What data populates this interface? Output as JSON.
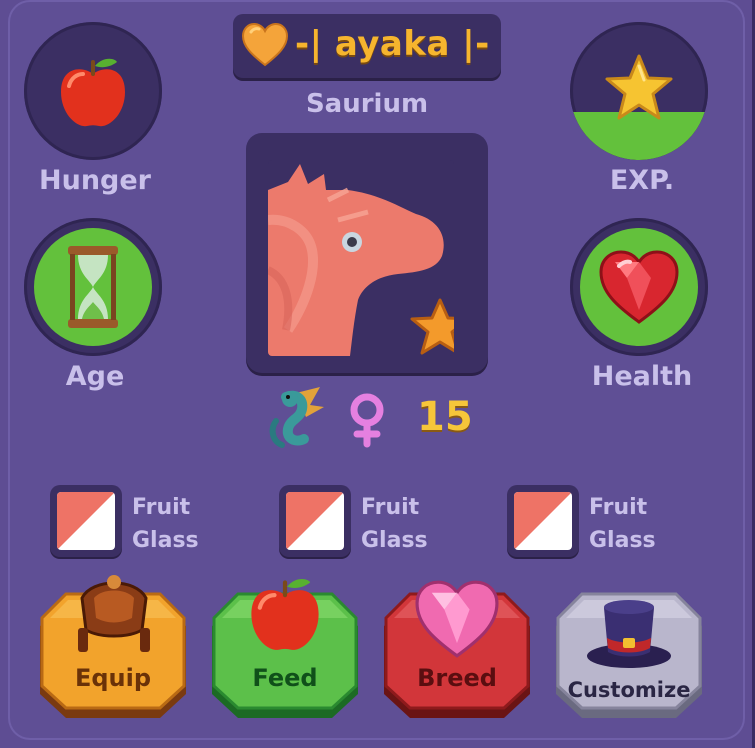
{
  "header": {
    "name": "-| ayaka |-",
    "species": "Saurium",
    "heart_icon": "orange-heart-icon"
  },
  "stats": {
    "hunger": {
      "label": "Hunger",
      "icon": "apple-icon"
    },
    "exp": {
      "label": "EXP.",
      "icon": "star-icon",
      "fill_fraction": 0.35
    },
    "age": {
      "label": "Age",
      "icon": "hourglass-icon"
    },
    "health": {
      "label": "Health",
      "icon": "heart-gem-icon"
    }
  },
  "portrait": {
    "badge_icon": "star-badge-icon"
  },
  "info": {
    "type_icon": "dragon-type-icon",
    "gender_icon": "female-icon",
    "level": "15"
  },
  "traits": [
    {
      "line1": "Fruit",
      "line2": "Glass"
    },
    {
      "line1": "Fruit",
      "line2": "Glass"
    },
    {
      "line1": "Fruit",
      "line2": "Glass"
    }
  ],
  "actions": {
    "equip": "Equip",
    "feed": "Feed",
    "breed": "Breed",
    "customize": "Customize"
  },
  "colors": {
    "panel": "#5f4f95",
    "dark": "#3b2f63",
    "green": "#63c13c",
    "gold": "#f6b52e",
    "label": "#c9c0ea",
    "swatch_red": "#ee7366"
  }
}
